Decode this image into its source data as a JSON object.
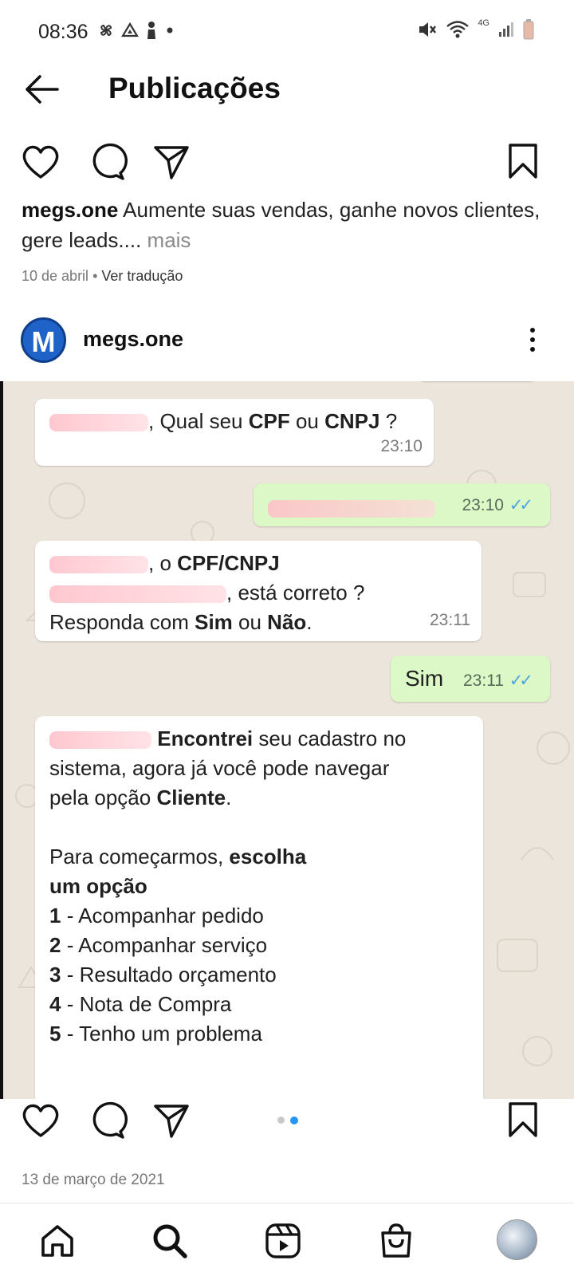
{
  "status_bar": {
    "time": "08:36",
    "left_icons": [
      "pinwheel-icon",
      "drive-icon",
      "figure-icon",
      "dot-icon"
    ],
    "right_icons": [
      "mute-icon",
      "wifi-icon",
      "signal-icon",
      "battery-icon"
    ],
    "network": "4G"
  },
  "header": {
    "title": "Publicações"
  },
  "caption": {
    "username": "megs.one",
    "text": " Aumente suas vendas, ganhe novos clientes, gere leads....",
    "more": " mais",
    "date": "10 de abril",
    "separator": "•",
    "translate": "Ver tradução"
  },
  "post": {
    "avatar_letter": "M",
    "username": "megs.one"
  },
  "chat": {
    "msg1": {
      "prefix": ", Qual seu ",
      "b1": "CPF",
      "mid": " ou ",
      "b2": "CNPJ",
      "suffix": " ?",
      "time": "23:10"
    },
    "msg2": {
      "time": "23:10"
    },
    "msg3": {
      "line1_pre": ", o ",
      "line1_b": "CPF/CNPJ",
      "line2": ", está correto ?",
      "line3_pre": "Responda com ",
      "line3_b1": "Sim",
      "line3_mid": " ou ",
      "line3_b2": "Não",
      "line3_suf": ".",
      "time": "23:11"
    },
    "msg4": {
      "text": "Sim",
      "time": "23:11"
    },
    "msg5": {
      "p1_b": "Encontrei",
      "p1_rest": " seu cadastro no",
      "p1_line2": "sistema, agora já você pode navegar",
      "p1_line3_pre": "pela opção ",
      "p1_line3_b": "Cliente",
      "p1_line3_suf": ".",
      "p2_pre": "Para começarmos, ",
      "p2_b": "escolha",
      "p2_line2_b": "um opção",
      "options": [
        {
          "num": "1",
          "label": " - Acompanhar pedido"
        },
        {
          "num": "2",
          "label": " - Acompanhar serviço"
        },
        {
          "num": "3",
          "label": " - Resultado orçamento"
        },
        {
          "num": "4",
          "label": " - Nota de Compra"
        },
        {
          "num": "5",
          "label": " - Tenho um problema"
        }
      ]
    }
  },
  "carousel": {
    "count": 2,
    "active": 2
  },
  "post_date": "13 de março de 2021",
  "nav": [
    "home-icon",
    "search-icon",
    "reels-icon",
    "shop-icon",
    "profile-avatar"
  ]
}
